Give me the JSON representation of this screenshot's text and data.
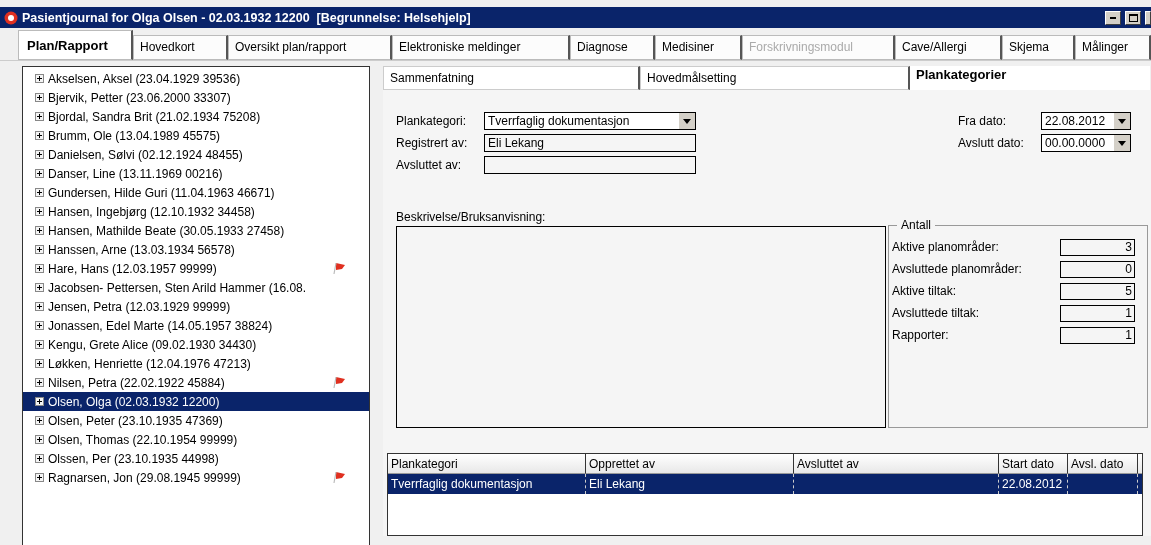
{
  "window": {
    "title": "Pasientjournal for Olga Olsen - 02.03.1932 12200  [Begrunnelse: Helsehjelp]"
  },
  "tabs": [
    {
      "label": "Plan/Rapport",
      "selected": true,
      "disabled": false
    },
    {
      "label": "Hovedkort",
      "selected": false,
      "disabled": false
    },
    {
      "label": "Oversikt plan/rapport",
      "selected": false,
      "disabled": false
    },
    {
      "label": "Elektroniske meldinger",
      "selected": false,
      "disabled": false
    },
    {
      "label": "Diagnose",
      "selected": false,
      "disabled": false
    },
    {
      "label": "Medisiner",
      "selected": false,
      "disabled": false
    },
    {
      "label": "Forskrivningsmodul",
      "selected": false,
      "disabled": true
    },
    {
      "label": "Cave/Allergi",
      "selected": false,
      "disabled": false
    },
    {
      "label": "Skjema",
      "selected": false,
      "disabled": false
    },
    {
      "label": "Målinger",
      "selected": false,
      "disabled": false
    }
  ],
  "patients": [
    {
      "label": "Akselsen, Aksel (23.04.1929 39536)",
      "selected": false,
      "flagged": false
    },
    {
      "label": "Bjervik, Petter (23.06.2000 33307)",
      "selected": false,
      "flagged": false
    },
    {
      "label": "Bjordal, Sandra Brit (21.02.1934 75208)",
      "selected": false,
      "flagged": false
    },
    {
      "label": "Brumm, Ole (13.04.1989 45575)",
      "selected": false,
      "flagged": false
    },
    {
      "label": "Danielsen, Sølvi (02.12.1924 48455)",
      "selected": false,
      "flagged": false
    },
    {
      "label": "Danser, Line (13.11.1969 00216)",
      "selected": false,
      "flagged": false
    },
    {
      "label": "Gundersen, Hilde Guri (11.04.1963 46671)",
      "selected": false,
      "flagged": false
    },
    {
      "label": "Hansen, Ingebjørg (12.10.1932 34458)",
      "selected": false,
      "flagged": false
    },
    {
      "label": "Hansen, Mathilde Beate (30.05.1933 27458)",
      "selected": false,
      "flagged": false
    },
    {
      "label": "Hanssen, Arne (13.03.1934 56578)",
      "selected": false,
      "flagged": false
    },
    {
      "label": "Hare, Hans (12.03.1957 99999)",
      "selected": false,
      "flagged": true
    },
    {
      "label": "Jacobsen- Pettersen, Sten Arild Hammer (16.08.",
      "selected": false,
      "flagged": false
    },
    {
      "label": "Jensen, Petra (12.03.1929 99999)",
      "selected": false,
      "flagged": false
    },
    {
      "label": "Jonassen, Edel Marte (14.05.1957 38824)",
      "selected": false,
      "flagged": false
    },
    {
      "label": "Kengu, Grete Alice (09.02.1930 34430)",
      "selected": false,
      "flagged": false
    },
    {
      "label": "Løkken, Henriette (12.04.1976 47213)",
      "selected": false,
      "flagged": false
    },
    {
      "label": "Nilsen, Petra (22.02.1922 45884)",
      "selected": false,
      "flagged": true
    },
    {
      "label": "Olsen, Olga (02.03.1932 12200)",
      "selected": true,
      "flagged": false
    },
    {
      "label": "Olsen, Peter (23.10.1935 47369)",
      "selected": false,
      "flagged": false
    },
    {
      "label": "Olsen, Thomas (22.10.1954 99999)",
      "selected": false,
      "flagged": false
    },
    {
      "label": "Olssen, Per (23.10.1935 44998)",
      "selected": false,
      "flagged": false
    },
    {
      "label": "Ragnarsen, Jon (29.08.1945 99999)",
      "selected": false,
      "flagged": true
    }
  ],
  "sub_tabs": [
    {
      "label": "Sammenfatning",
      "selected": false
    },
    {
      "label": "Hovedmålsetting",
      "selected": false
    },
    {
      "label": "Plankategorier",
      "selected": true
    }
  ],
  "form": {
    "plankategori": {
      "label": "Plankategori:",
      "value": "Tverrfaglig dokumentasjon"
    },
    "registrert_av": {
      "label": "Registrert av:",
      "value": "Eli Lekang"
    },
    "avsluttet_av": {
      "label": "Avsluttet av:"
    },
    "fra_dato": {
      "label": "Fra dato:",
      "value": "22.08.2012"
    },
    "avslutt_dato": {
      "label": "Avslutt dato:",
      "value": "00.00.0000"
    }
  },
  "description": {
    "label": "Beskrivelse/Bruksanvisning:"
  },
  "counts": {
    "title": "Antall",
    "rows": [
      {
        "label": "Aktive planområder:",
        "value": "3"
      },
      {
        "label": "Avsluttede planområder:",
        "value": "0"
      },
      {
        "label": "Aktive tiltak:",
        "value": "5"
      },
      {
        "label": "Avsluttede tiltak:",
        "value": "1"
      },
      {
        "label": "Rapporter:",
        "value": "1"
      }
    ]
  },
  "table": {
    "columns": [
      "Plankategori",
      "Opprettet av",
      "Avsluttet av",
      "Start dato",
      "Avsl. dato"
    ],
    "rows": [
      {
        "cells": [
          "Tverrfaglig dokumentasjon",
          "Eli Lekang",
          null,
          "22.08.2012",
          null
        ],
        "selected": true
      }
    ]
  }
}
